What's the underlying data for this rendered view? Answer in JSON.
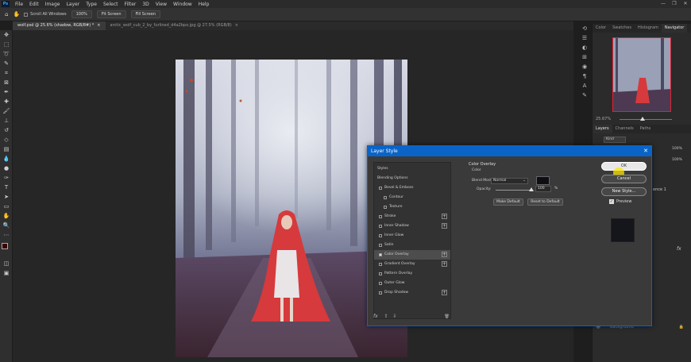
{
  "app": {
    "logo": "Ps"
  },
  "menu": [
    "File",
    "Edit",
    "Image",
    "Layer",
    "Type",
    "Select",
    "Filter",
    "3D",
    "View",
    "Window",
    "Help"
  ],
  "window_controls": [
    "—",
    "❐",
    "✕"
  ],
  "options_bar": {
    "scroll_all_windows": "Scroll All Windows",
    "zoom": "100%",
    "fit_screen": "Fit Screen",
    "fill_screen": "Fill Screen"
  },
  "doc_tabs": [
    {
      "label": "wolf.psd @ 25.6% (shadow, RGB/8#) *",
      "close": "×"
    },
    {
      "label": "arctic_wolf_cub_2_by_furlined_d4a2bpo.jpg @ 27.5% (RGB/8)",
      "close": "×"
    }
  ],
  "panel_tabs_top": [
    "Color",
    "Swatches",
    "Histogram",
    "Navigator"
  ],
  "navigator": {
    "zoom": "25.67%"
  },
  "layers_tabs": [
    "Layers",
    "Channels",
    "Paths"
  ],
  "layers": {
    "kind_placeholder": "Kind",
    "opacity_label": "100%",
    "fill_label": "100%",
    "visible_layer": "Background",
    "partial_layer": "ence 1",
    "fx": "fx"
  },
  "dialog": {
    "title": "Layer Style",
    "close": "✕",
    "styles_header": "Styles",
    "blending_options": "Blending Options",
    "styles": [
      {
        "label": "Bevel & Emboss",
        "checked": false,
        "plus": false,
        "indent": false
      },
      {
        "label": "Contour",
        "checked": false,
        "plus": false,
        "indent": true
      },
      {
        "label": "Texture",
        "checked": false,
        "plus": false,
        "indent": true
      },
      {
        "label": "Stroke",
        "checked": false,
        "plus": true,
        "indent": false
      },
      {
        "label": "Inner Shadow",
        "checked": false,
        "plus": true,
        "indent": false
      },
      {
        "label": "Inner Glow",
        "checked": false,
        "plus": false,
        "indent": false
      },
      {
        "label": "Satin",
        "checked": false,
        "plus": false,
        "indent": false
      },
      {
        "label": "Color Overlay",
        "checked": true,
        "plus": true,
        "indent": false,
        "selected": true
      },
      {
        "label": "Gradient Overlay",
        "checked": false,
        "plus": true,
        "indent": false
      },
      {
        "label": "Pattern Overlay",
        "checked": false,
        "plus": false,
        "indent": false
      },
      {
        "label": "Outer Glow",
        "checked": false,
        "plus": false,
        "indent": false
      },
      {
        "label": "Drop Shadow",
        "checked": false,
        "plus": true,
        "indent": false
      }
    ],
    "footer_fx": "fx",
    "footer_up": "⇧",
    "footer_down": "⇩",
    "footer_trash": "🗑",
    "section_title": "Color Overlay",
    "subsection": "Color",
    "blend_mode_label": "Blend Mode:",
    "blend_mode_value": "Normal",
    "overlay_color": "#0e0e14",
    "opacity_label": "Opacity:",
    "opacity_value": "100",
    "opacity_unit": "%",
    "opacity_level": 1.0,
    "make_default": "Make Default",
    "reset_default": "Reset to Default",
    "ok": "OK",
    "cancel": "Cancel",
    "new_style": "New Style...",
    "preview_label": "Preview",
    "preview_checked": true
  }
}
